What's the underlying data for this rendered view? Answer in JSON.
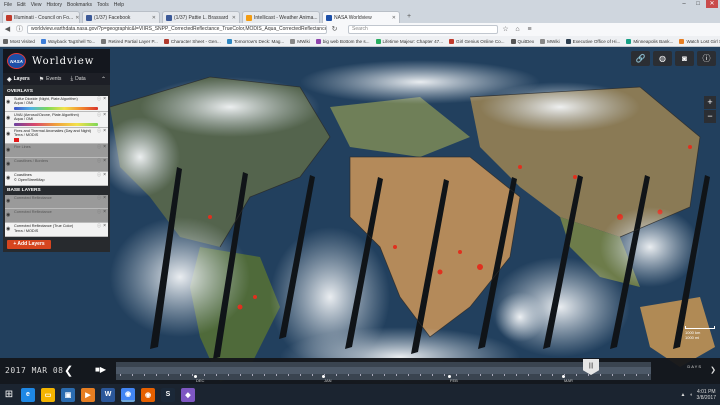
{
  "browser": {
    "menu": [
      "File",
      "Edit",
      "View",
      "History",
      "Bookmarks",
      "Tools",
      "Help"
    ],
    "tabs": [
      {
        "label": "Illuminati - Council on Fo...",
        "color": "#c0392b",
        "active": false
      },
      {
        "label": "(1/37) Facebook",
        "color": "#3b5998",
        "active": false
      },
      {
        "label": "(1/37) Pattie L. Brassard",
        "color": "#3b5998",
        "active": false
      },
      {
        "label": "Intellicast - Weather Anima...",
        "color": "#f39c12",
        "active": false
      },
      {
        "label": "NASA Worldview",
        "color": "#1c4fa8",
        "active": true
      }
    ],
    "url": "worldview.earthdata.nasa.gov/?p=geographic&l=VIIRS_SNPP_CorrectedReflectance_TrueColor,MODIS_Aqua_CorrectedReflectance_T...",
    "search_placeholder": "Search",
    "bookmarks": [
      {
        "label": "Most Visited",
        "color": "#666"
      },
      {
        "label": "Wayback TagShell To...",
        "color": "#3b7dd8"
      },
      {
        "label": "Retired Partial Layer P...",
        "color": "#777"
      },
      {
        "label": "Character Sheet - Gen...",
        "color": "#b03a2e"
      },
      {
        "label": "Tomorrow's Deck: Mag...",
        "color": "#2e86c1"
      },
      {
        "label": "MWiki",
        "color": "#888"
      },
      {
        "label": "big web Bottom the s...",
        "color": "#8e44ad"
      },
      {
        "label": "Lifetime Majeur: Chapter 47...",
        "color": "#27ae60"
      },
      {
        "label": "Girl Genius Online Co...",
        "color": "#c0392b"
      },
      {
        "label": "QuitDex",
        "color": "#555"
      },
      {
        "label": "MWiki",
        "color": "#888"
      },
      {
        "label": "Executive Office of Hi...",
        "color": "#2c3e50"
      },
      {
        "label": "Minneapolis Bank...",
        "color": "#16a085"
      },
      {
        "label": "Watch Lost Girl Seas...",
        "color": "#e67e22"
      }
    ]
  },
  "app": {
    "logo_text": "NASA",
    "title": "Worldview",
    "tabs": [
      {
        "label": "Layers",
        "icon": "layers-icon",
        "active": true
      },
      {
        "label": "Events",
        "icon": "events-icon",
        "active": false
      },
      {
        "label": "Data",
        "icon": "download-icon",
        "active": false
      }
    ],
    "overlays_heading": "OVERLAYS",
    "overlays": [
      {
        "title": "Sulfur Dioxide (Night, Plate Algorithm)",
        "sub": "Aqua / OMI",
        "bar": "linear-gradient(90deg,#3b4fc5,#4fb2e6,#7ed957,#f2e34a,#f28a2e,#d8322b)",
        "dim": false
      },
      {
        "title": "UVAI (Aerosol/Ozone, Plate Algorithm)",
        "sub": "Aqua / OMI",
        "bar": "linear-gradient(90deg,#6a3fa0,#d9486b,#f0a03b,#f3e14b,#7dd657)",
        "dim": false
      },
      {
        "title": "Fires and Thermal Anomalies (Day and Night)",
        "sub": "Terra / MODIS",
        "bar": "",
        "dim": false
      },
      {
        "title": "Fire Lines",
        "sub": "",
        "bar": "",
        "dim": true
      },
      {
        "title": "Coastlines / Borders",
        "sub": "",
        "bar": "",
        "dim": true
      },
      {
        "title": "Coastlines",
        "sub": "© OpenStreetMap",
        "bar": "",
        "dim": false
      }
    ],
    "base_heading": "BASE LAYERS",
    "baselayers": [
      {
        "title": "Corrected Reflectance",
        "sub": "",
        "dim": true
      },
      {
        "title": "Corrected Reflectance",
        "sub": "",
        "dim": true
      },
      {
        "title": "Corrected Reflectance (True Color)",
        "sub": "Terra / MODIS",
        "dim": false
      }
    ],
    "add_layers_label": "+ Add Layers",
    "scale_top": "1000 km",
    "scale_bottom": "1000 mi"
  },
  "timeline": {
    "date": "2017 MAR 08",
    "months": [
      "DEC",
      "JAN",
      "FEB",
      "MAR"
    ],
    "handle_label": "|||",
    "interval": "DAYS"
  },
  "taskbar": {
    "time": "4:01 PM",
    "date": "3/8/2017",
    "apps": [
      {
        "name": "ie",
        "glyph": "e",
        "color": "#1e88e5"
      },
      {
        "name": "folder",
        "glyph": "▭",
        "color": "#f4b400"
      },
      {
        "name": "store",
        "glyph": "▣",
        "color": "#2b6cb0"
      },
      {
        "name": "media",
        "glyph": "▶",
        "color": "#e67e22"
      },
      {
        "name": "word",
        "glyph": "W",
        "color": "#2b579a"
      },
      {
        "name": "chrome",
        "glyph": "◉",
        "color": "#4285f4"
      },
      {
        "name": "firefox",
        "glyph": "◉",
        "color": "#e66000"
      },
      {
        "name": "steam",
        "glyph": "S",
        "color": "#1b2838"
      },
      {
        "name": "misc",
        "glyph": "◆",
        "color": "#7e57c2"
      }
    ]
  }
}
